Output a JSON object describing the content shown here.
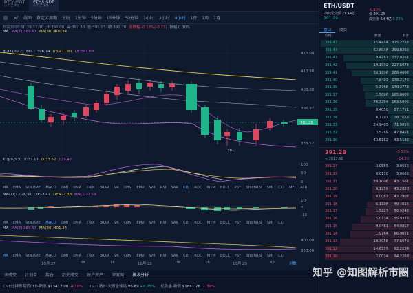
{
  "tabs": [
    {
      "label": "BTC/USDT",
      "sub": "火币全球站"
    },
    {
      "label": "ETH/USDT",
      "sub": "火币全球站"
    }
  ],
  "toolbar": {
    "items": [
      "线图",
      "分时",
      "1分钟",
      "5分钟",
      "15分钟",
      "30分钟",
      "1小时",
      "2小时",
      "4小时"
    ],
    "custom_period": "自定义周期",
    "active": "4小时",
    "right": [
      "1日",
      "1周",
      "1月"
    ]
  },
  "infobar": {
    "time": "时间2020 10.29 12:00",
    "open": "开:392.00",
    "high": "高:392.30",
    "low": "低:391.13",
    "close": "收:391.28",
    "change": "涨跌幅:-0.18%(-0.72)",
    "amp": "振幅:0.30%",
    "ma_label": "MA",
    "ma7": "MA(7):389.67",
    "ma30": "MA(30):401.34",
    "boll_label": "BOLL(20,2)",
    "boll": "BOLL:396.74",
    "ub": "UB:411.81",
    "lb": "LB:381.68"
  },
  "price_axis": [
    "418.04",
    "410.90",
    "403.88",
    "396.97",
    "391.28",
    "383.52"
  ],
  "current_price": "391.28",
  "low_marker": "381",
  "kdj": {
    "label": "KDJ(9,3,3)",
    "k": "K:32.17",
    "d": "D:33.52",
    "j": "J:29.47",
    "axis": [
      "100",
      "50",
      "0"
    ]
  },
  "macd": {
    "label": "MACD(12,26,9)",
    "dif": "DIF:-3.47",
    "dea": "DEA:-2.38",
    "macd": "MACD:-2.19",
    "axis": [
      "10",
      "0",
      "-10"
    ]
  },
  "ma_pane": {
    "label": "MA",
    "ma7": "MA(7):389.67",
    "ma30": "MA(30):401.34",
    "axis": [
      "400.00",
      "350.00"
    ]
  },
  "indicators_top": [
    "MA",
    "EMA",
    "VOLUME",
    "MACD",
    "DMI",
    "DMA",
    "TRIX",
    "BRAR",
    "VR",
    "OBV",
    "EMV",
    "WR",
    "RSI",
    "SAR",
    "KDJ",
    "ROC",
    "MTM",
    "BOLL",
    "PSY",
    "StochRSI",
    "SMI",
    "CCI",
    "MFI",
    "ATR"
  ],
  "indicators_mid": [
    "MA",
    "EMA",
    "VOLUME",
    "MACD",
    "DMI",
    "DMA",
    "TRIX",
    "BRAR",
    "VR",
    "OBV",
    "EMV",
    "WR",
    "RSI",
    "SAR",
    "KDJ",
    "ROC",
    "MTM",
    "BOLL",
    "PSY",
    "StochRSI",
    "SMI",
    "CCI"
  ],
  "indicators_bottom": [
    "MA",
    "EMA",
    "VOLUME",
    "MACD",
    "DMI",
    "DMA",
    "TRIX",
    "BRAR",
    "VR",
    "OBV",
    "EMV",
    "WR",
    "RSI",
    "SAR",
    "KDJ",
    "ROC",
    "MTM",
    "BOLL",
    "PSY",
    "StochRSI",
    "SMI",
    "CCI"
  ],
  "x_axis": [
    "10月 27",
    "08",
    "16",
    "10月 28",
    "08",
    "16",
    "10月 29",
    "08"
  ],
  "x_right": "对数",
  "bottom_tabs": [
    "未成交",
    "计划单",
    "持仓",
    "历史成交",
    "账户资产",
    "深度图",
    "技术分析"
  ],
  "ticker": [
    {
      "name": "CME比特币期货CFD-新浪",
      "price": "$13412.00",
      "chg": "-4.10%",
      "dir": "down"
    },
    {
      "name": "USDT场外-火币全球站",
      "price": "¥6.69",
      "chg": "+0.75%",
      "dir": "up"
    },
    {
      "name": "伦敦金-新浪",
      "price": "$1881.76",
      "chg": "-1.39%",
      "dir": "down"
    }
  ],
  "right": {
    "pair": "ETH/USDT",
    "pair_sub": "火币全球站",
    "last": "391.29",
    "change_pct": "-0.13%",
    "vol_label": "24H成交额",
    "vol": "21.44亿",
    "low_label": "低",
    "low": "391.28",
    "turn_label": "成交量",
    "turn": "5.64亿",
    "turn_pct": "0.73%",
    "tabs": [
      "盘口",
      "成交"
    ],
    "headers": [
      "价格",
      "数量",
      "累计"
    ],
    "bids": [
      [
        "391.47",
        "15.4454",
        "315.2753"
      ],
      [
        "391.44",
        "62.8038",
        "299.8299"
      ],
      [
        "391.43",
        "9.4187",
        "237.0261"
      ],
      [
        "391.42",
        "19.1992",
        "227.6074"
      ],
      [
        "391.41",
        "30.1906",
        "208.4082"
      ],
      [
        "391.40",
        "7.8403",
        "178.2176"
      ],
      [
        "391.39",
        "5.3768",
        "170.3773"
      ],
      [
        "391.37",
        "1.5000",
        "165.0005"
      ],
      [
        "391.36",
        "76.3294",
        "163.5005"
      ],
      [
        "391.35",
        "8.4058",
        "87.1711"
      ],
      [
        "391.34",
        "6.7797",
        "78.7653"
      ],
      [
        "391.33",
        "24.9405",
        "71.9856"
      ],
      [
        "391.32",
        "3.5269",
        "47.0451"
      ],
      [
        "391.30",
        "43.5182",
        "43.5182"
      ]
    ],
    "mid_price": "391.28",
    "mid_pct": "-3.53%",
    "mid_cny": "≈ 2617.66",
    "mid_chg": "-14.30",
    "asks": [
      [
        "391.27",
        "3.0555",
        "3.0555"
      ],
      [
        "391.23",
        "0.0110",
        "3.0665"
      ],
      [
        "391.21",
        "39.1006",
        "43.1561"
      ],
      [
        "391.20",
        "0.1259",
        "43.2820"
      ],
      [
        "391.19",
        "0.0087",
        "43.2907"
      ],
      [
        "391.18",
        "6.1108",
        "49.4015"
      ],
      [
        "391.17",
        "1.5227",
        "50.9242"
      ],
      [
        "391.16",
        "5.0134",
        "55.9376"
      ],
      [
        "391.15",
        "9.0481",
        "64.9857"
      ],
      [
        "391.14",
        "1.9164",
        "66.9021"
      ],
      [
        "391.13",
        "10.7058",
        "77.6079"
      ],
      [
        "391.12",
        "14.6155",
        "92.2234"
      ],
      [
        "391.10",
        "2.0034",
        "94.2268"
      ]
    ]
  },
  "watermark": "知乎 @知图解析市圈"
}
